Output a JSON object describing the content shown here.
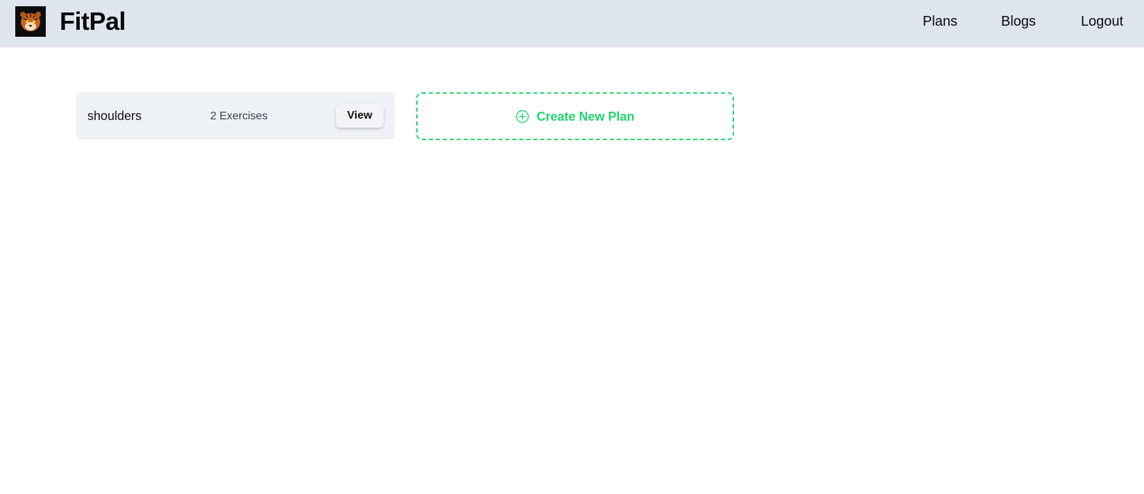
{
  "navbar": {
    "brand": "FitPal",
    "logo_icon": "tiger-head-icon",
    "links": [
      {
        "label": "Plans"
      },
      {
        "label": "Blogs"
      },
      {
        "label": "Logout"
      }
    ]
  },
  "plans": [
    {
      "name": "shoulders",
      "exercise_count": "2 Exercises",
      "view_label": "View"
    }
  ],
  "create_plan": {
    "label": "Create New Plan",
    "icon": "plus-circle-icon"
  },
  "colors": {
    "navbar_bg": "#dfe5ef",
    "card_bg": "#eef1f6",
    "accent_green": "#22d46e"
  }
}
